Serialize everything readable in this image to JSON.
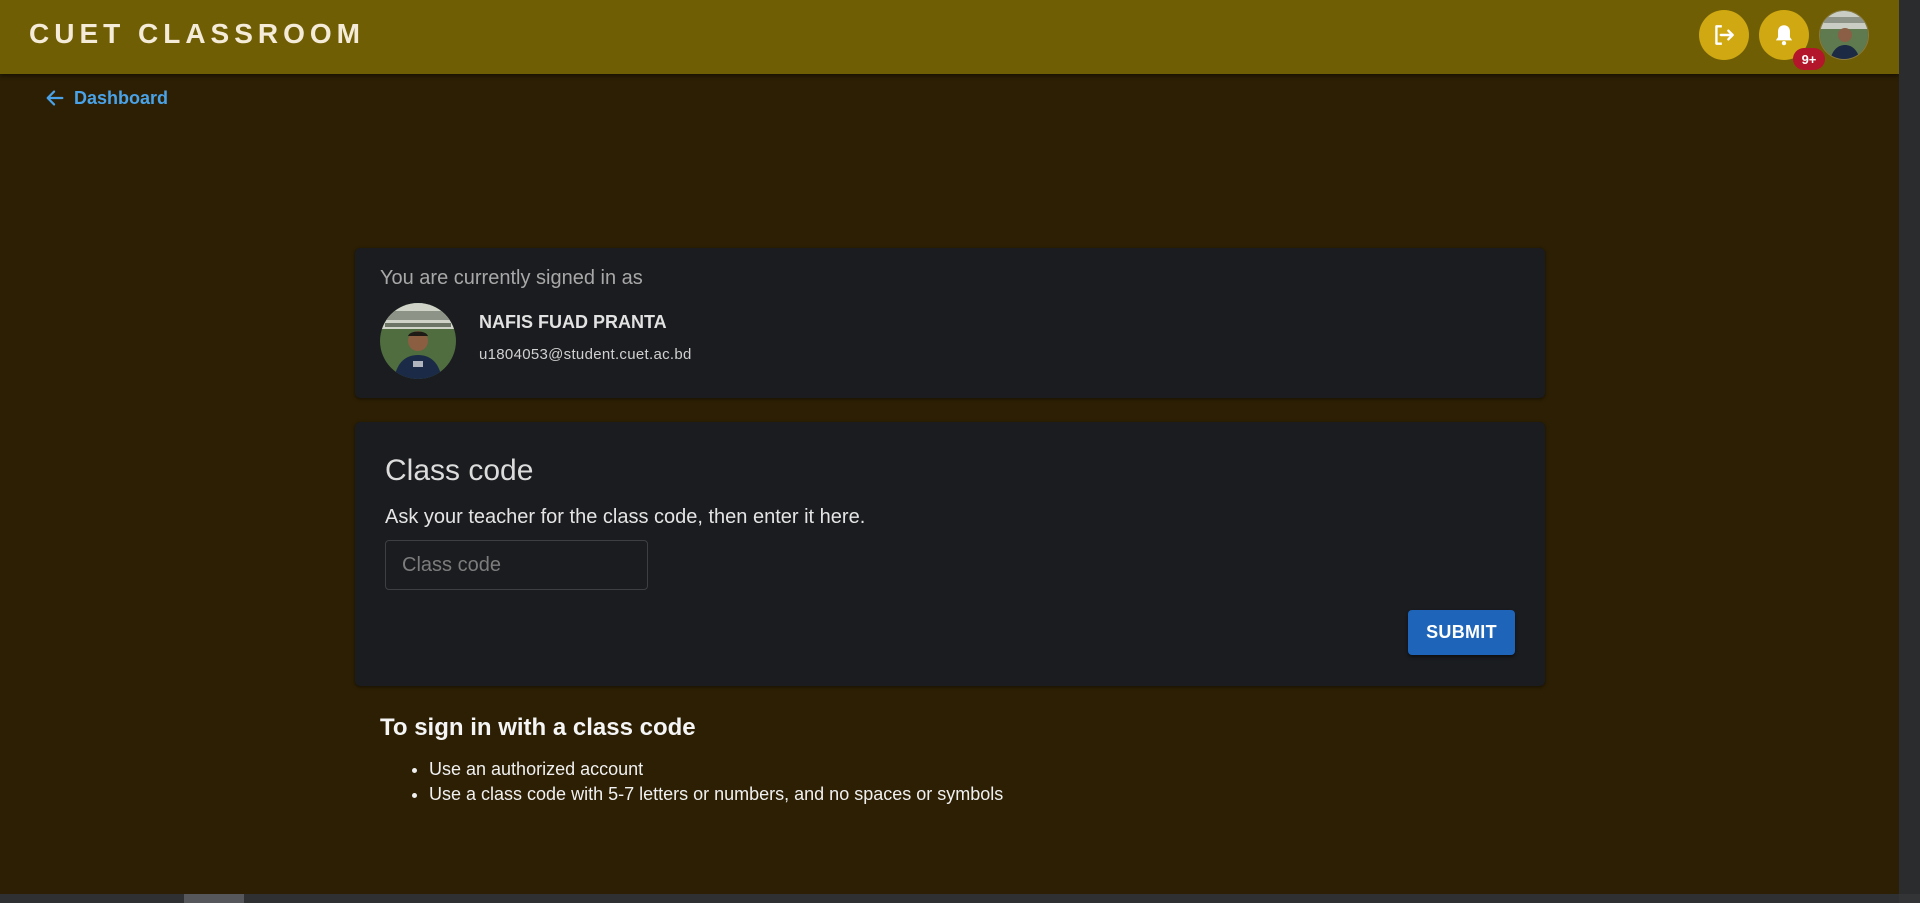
{
  "header": {
    "brand": "CUET CLASSROOM",
    "notification_badge": "9+",
    "icons": [
      "logout-icon",
      "bell-icon",
      "avatar"
    ]
  },
  "nav": {
    "back_label": "Dashboard"
  },
  "account": {
    "signed_in_label": "You are currently signed in as",
    "name": "NAFIS FUAD PRANTA",
    "email": "u1804053@student.cuet.ac.bd"
  },
  "class_code": {
    "title": "Class code",
    "description": "Ask your teacher for the class code, then enter it here.",
    "input_placeholder": "Class code",
    "input_value": "",
    "submit_label": "SUBMIT"
  },
  "help": {
    "title": "To sign in with a class code",
    "items": [
      "Use an authorized account",
      "Use a class code with 5-7 letters or numbers, and no spaces or symbols"
    ]
  },
  "colors": {
    "topbar": "#705e04",
    "background": "#2c1f04",
    "card": "#1b1c1f",
    "accent_button": "#1e64b8",
    "link": "#4aa3e8",
    "icon_button": "#d0a811",
    "badge": "#b3152a"
  }
}
